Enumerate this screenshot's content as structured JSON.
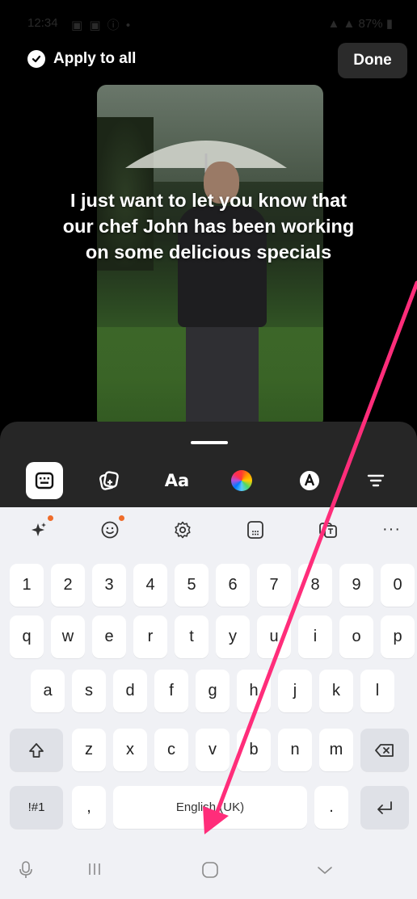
{
  "status_bar": {
    "time": "12:34",
    "icons": "▣ ▣ ⓘ •",
    "right": "▲ ▲ 87% ▮"
  },
  "top_bar": {
    "apply_to_all_label": "Apply to all",
    "done_label": "Done"
  },
  "caption_lines": [
    "I just want to let you know that",
    "our chef John has been working",
    "on some delicious specials"
  ],
  "editor_tools": [
    {
      "name": "keyboard-icon",
      "selected": true
    },
    {
      "name": "sticker-add-icon",
      "selected": false
    },
    {
      "name": "text-style-icon",
      "label": "Aa",
      "selected": false
    },
    {
      "name": "color-wheel-icon",
      "selected": false
    },
    {
      "name": "text-outline-icon",
      "selected": false
    },
    {
      "name": "align-icon",
      "selected": false
    }
  ],
  "keyboard": {
    "toolbar": [
      "ai-sparkle-icon",
      "emoji-icon",
      "settings-icon",
      "keypad-icon",
      "translate-icon",
      "more-icon"
    ],
    "more_label": "···",
    "rows": {
      "numbers": [
        "1",
        "2",
        "3",
        "4",
        "5",
        "6",
        "7",
        "8",
        "9",
        "0"
      ],
      "row1": [
        "q",
        "w",
        "e",
        "r",
        "t",
        "y",
        "u",
        "i",
        "o",
        "p"
      ],
      "row2": [
        "a",
        "s",
        "d",
        "f",
        "g",
        "h",
        "j",
        "k",
        "l"
      ],
      "row3": [
        "z",
        "x",
        "c",
        "v",
        "b",
        "n",
        "m"
      ]
    },
    "symbols_label": "!#1",
    "comma_label": ",",
    "space_label": "English (UK)",
    "period_label": "."
  },
  "colors": {
    "annotation_arrow": "#ff2d7a",
    "badge": "#ef6c2a"
  }
}
